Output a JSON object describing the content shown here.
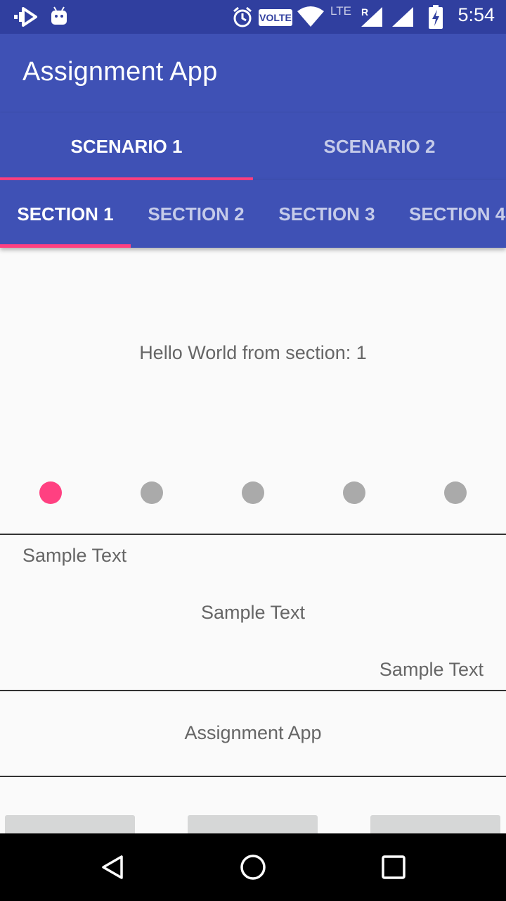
{
  "status_bar": {
    "time": "5:54",
    "volte_label": "VOLTE",
    "lte_label": "LTE",
    "roaming_label": "R",
    "icons": [
      "app-logo-icon",
      "android-icon",
      "alarm-icon",
      "volte-icon",
      "wifi-icon",
      "signal-roaming-icon",
      "signal-icon",
      "battery-charging-icon"
    ]
  },
  "app_bar": {
    "title": "Assignment App"
  },
  "scenario_tabs": {
    "tabs": [
      {
        "label": "SCENARIO 1",
        "active": true
      },
      {
        "label": "SCENARIO 2",
        "active": false
      }
    ]
  },
  "section_tabs": {
    "tabs": [
      {
        "label": "SECTION 1",
        "active": true
      },
      {
        "label": "SECTION 2",
        "active": false
      },
      {
        "label": "SECTION 3",
        "active": false
      },
      {
        "label": "SECTION 4",
        "active": false
      }
    ]
  },
  "page": {
    "hello_text": "Hello World from section: 1",
    "page_indicator": {
      "count": 5,
      "active_index": 1
    }
  },
  "samples": {
    "left": "Sample Text",
    "center": "Sample Text",
    "right": "Sample Text"
  },
  "footer": {
    "title": "Assignment App"
  },
  "colors": {
    "primary": "#3f51b5",
    "primary_dark": "#303f9f",
    "accent": "#ff4081",
    "dot_inactive": "#aaaaaa"
  },
  "nav_bar": {
    "icons": [
      "back-icon",
      "home-icon",
      "recents-icon"
    ]
  }
}
